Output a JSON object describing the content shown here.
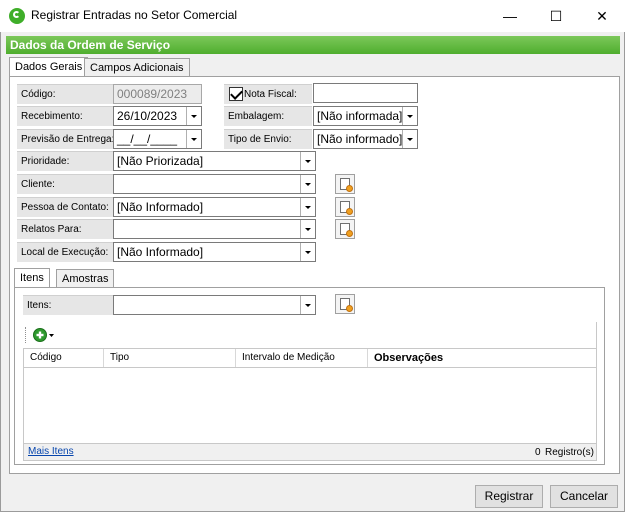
{
  "window": {
    "title": "Registrar Entradas no Setor Comercial",
    "min": "—",
    "max": "☐",
    "close": "✕"
  },
  "section_title": "Dados da Ordem de Serviço",
  "tabs": [
    {
      "label": "Dados Gerais"
    },
    {
      "label": "Campos Adicionais"
    }
  ],
  "form": {
    "codigo": {
      "label": "Código:",
      "value": "000089/2023"
    },
    "nota_fiscal": {
      "label": "Nota Fiscal:",
      "value": ""
    },
    "recebimento": {
      "label": "Recebimento:",
      "value": "26/10/2023"
    },
    "embalagem": {
      "label": "Embalagem:",
      "value": "[Não informada]"
    },
    "previsao": {
      "label": "Previsão de Entrega:",
      "value": "__/__/____"
    },
    "tipo_envio": {
      "label": "Tipo de Envio:",
      "value": "[Não informado]"
    },
    "prioridade": {
      "label": "Prioridade:",
      "value": "[Não Priorizada]"
    },
    "cliente": {
      "label": "Cliente:",
      "value": ""
    },
    "pessoa_contato": {
      "label": "Pessoa de Contato:",
      "value": "[Não Informado]"
    },
    "relatos_para": {
      "label": "Relatos Para:",
      "value": ""
    },
    "local_execucao": {
      "label": "Local de Execução:",
      "value": "[Não Informado]"
    }
  },
  "inner_tabs": [
    {
      "label": "Itens"
    },
    {
      "label": "Amostras"
    }
  ],
  "itens": {
    "label": "Itens:",
    "value": "",
    "columns": [
      "Código",
      "Tipo",
      "Intervalo de Medição",
      "Observações"
    ],
    "footer_link": "Mais Itens",
    "count": "0",
    "count_label": "Registro(s)"
  },
  "buttons": {
    "registrar": "Registrar",
    "cancelar": "Cancelar"
  }
}
